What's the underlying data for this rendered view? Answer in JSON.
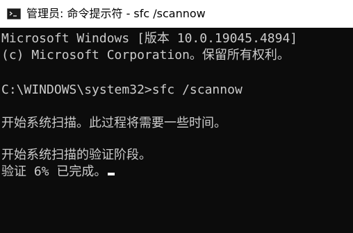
{
  "window": {
    "title": "管理员: 命令提示符 - sfc  /scannow",
    "icon": "cmd-icon"
  },
  "console": {
    "lines": [
      "Microsoft Windows [版本 10.0.19045.4894]",
      "(c) Microsoft Corporation。保留所有权利。",
      "",
      "C:\\WINDOWS\\system32>sfc /scannow",
      "",
      "开始系统扫描。此过程将需要一些时间。",
      "",
      "开始系统扫描的验证阶段。",
      "验证 6% 已完成。"
    ],
    "progress_percent": 6,
    "text_color": "#cccccc",
    "background_color": "#0c0c0c"
  }
}
